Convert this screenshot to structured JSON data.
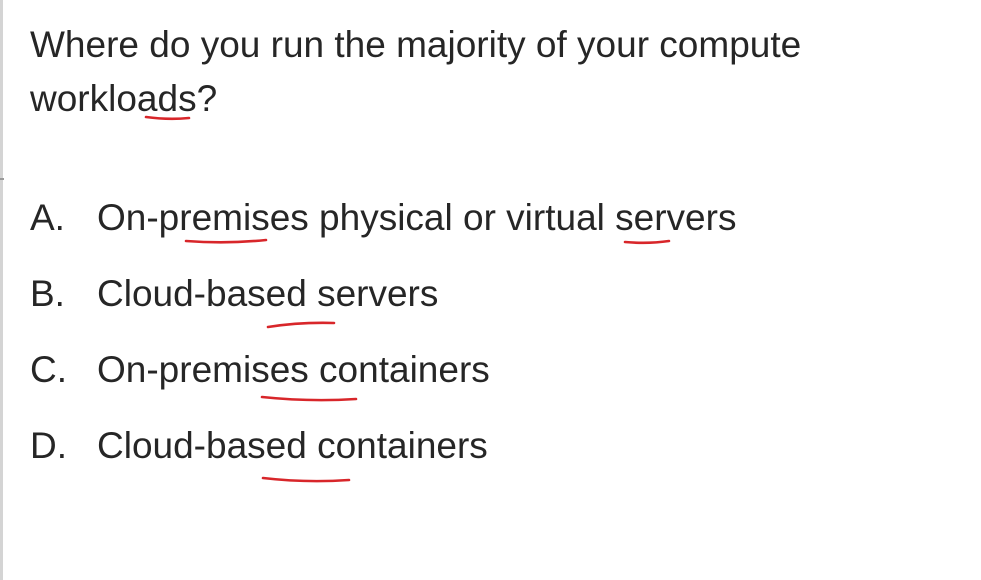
{
  "question": {
    "text": "Where do you run the majority of your compute workloads?"
  },
  "options": [
    {
      "letter": "A.",
      "text": "On-premises physical or virtual servers"
    },
    {
      "letter": "B.",
      "text": "Cloud-based servers"
    },
    {
      "letter": "C.",
      "text": "On-premises containers"
    },
    {
      "letter": "D.",
      "text": "Cloud-based containers"
    }
  ],
  "colors": {
    "text": "#262626",
    "annotation_ink": "#d8262a",
    "background": "#ffffff"
  }
}
